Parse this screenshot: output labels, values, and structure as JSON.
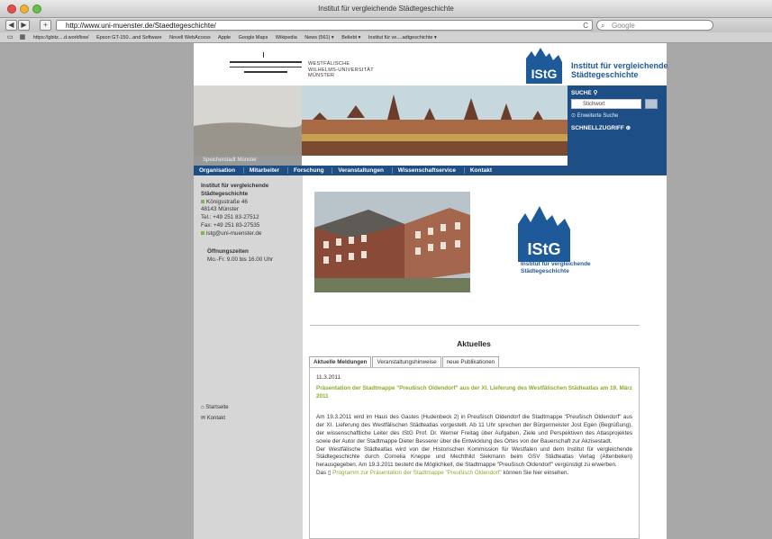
{
  "browser": {
    "title": "Institut für vergleichende Städtegeschichte",
    "back": "◀",
    "forward": "▶",
    "add": "+",
    "url": "http://www.uni-muenster.de/Staedtegeschichte/",
    "reload": "C",
    "search_placeholder": "Google",
    "bookmarks": [
      "https://gbitz....d.workflow/",
      "Epson GT-150...and Software",
      "Novell WebAccess",
      "Apple",
      "Google Maps",
      "Wikipedia",
      "News (561) ▾",
      "Beliebt ▾",
      "Institut für ve....adtgeschichte ▾"
    ]
  },
  "header": {
    "university": [
      "Westfälische",
      "Wilhelms-Universität",
      "Münster"
    ],
    "institute": "Institut für vergleichende Städtegeschichte",
    "logo_text": "IStG",
    "search_label": "SUCHE",
    "search_placeholder": "Stichwort",
    "advanced_search": "Erweiterte Suche",
    "quick_access": "SCHNELLZUGRIFF",
    "panorama_caption": "Speicherstadt Münster"
  },
  "nav": [
    "Organisation",
    "Mitarbeiter",
    "Forschung",
    "Veranstaltungen",
    "Wissenschaftservice",
    "Kontakt"
  ],
  "sidebar": {
    "name1": "Institut für vergleichende",
    "name2": "Städtegeschichte",
    "street": "Königsstraße 46",
    "city": "48143 Münster",
    "tel": "Tel.: +49 251 83-27512",
    "fax": "Fax: +49 251 83-27535",
    "email": "istg@uni-muenster.de",
    "hours_label": "Öffnungszeiten",
    "hours": "Mo.-Fr. 9.00 bis 16.00 Uhr",
    "link_start": "Startseite",
    "link_contact": "Kontakt"
  },
  "main": {
    "logo_caption1": "Institut für vergleichende",
    "logo_caption2": "Städtegeschichte",
    "section_title": "Aktuelles",
    "tabs": [
      "Aktuelle Meldungen",
      "Veranstaltungshinweise",
      "neue Publikationen"
    ],
    "news_date": "11.3.2011",
    "news_headline": "Präsentation der Stadtmappe \"Preußisch Oldendorf\" aus der XI. Lieferung des Westfälischen Städteatlas am 19. März 2011",
    "para1": "Am 19.3.2011 wird im Haus des Gastes (Hudenbeck 2) in Preußisch Oldendorf die Stadtmappe \"Preußisch Oldendorf\" aus der XI. Lieferung des Westfälischen Städteatlas vorgestellt. Ab 11 Uhr sprechen der Bürgermeister Jost Egen (Begrüßung), der wissenschaftliche Leiter des IStG Prof. Dr. Werner Freitag über Aufgaben, Ziele und Perspektiven des Atlasprojektes sowie der Autor der Stadtmappe Dieter Besserer über die Entwicklung des Ortes von der Bauerschaft zur Akzisestadt.",
    "para2": "Der Westfälische Städteatlas wird von der Historischen Kommission für Westfalen und dem Institut für vergleichende Städtegeschichte durch Cornelia Kneppe und Mechthild Siekmann beim GSV Städteatlas Verlag (Altenbeken) herausgegeben. Am 19.3.2011 besteht die Möglichkeit, die Stadtmappe \"Preußisch Oldendorf\" vergünstigt zu erwerben.",
    "para3_pre": "Das",
    "para3_link": "Programm zur Präsentation der Stadtmappe \"Preußisch Oldendorf\"",
    "para3_post": "können Sie hier einsehen."
  },
  "colors": {
    "brand_blue": "#1e4e86",
    "link_green": "#8aac26",
    "sidebar_gray": "#d6d6d6"
  }
}
